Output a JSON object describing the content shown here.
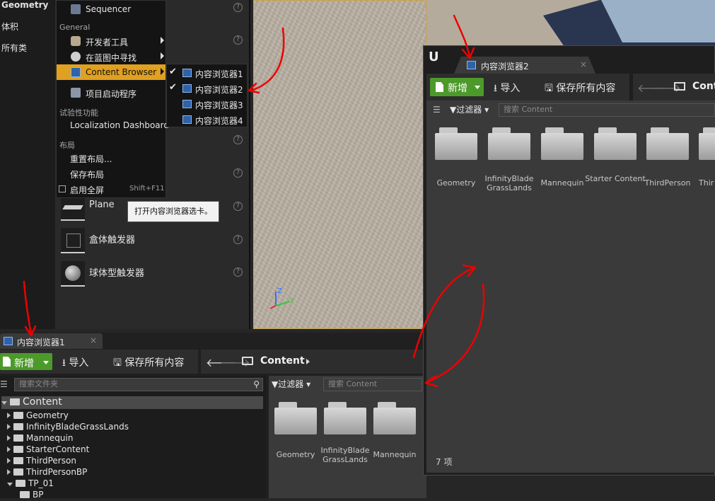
{
  "left_categories": [
    "Geometry",
    "体积",
    "所有类"
  ],
  "place_items": [
    {
      "label": "Plane"
    },
    {
      "label": "盒体触发器"
    },
    {
      "label": "球体型触发器"
    }
  ],
  "window_menu": {
    "top_item": "Sequencer",
    "section_general": "General",
    "dev_tools": "开发者工具",
    "find_in_blueprints": "在蓝图中寻找",
    "content_browser": "Content Browser",
    "project_launcher": "项目启动程序",
    "section_experimental": "试验性功能",
    "localization_dashboard": "Localization Dashboard",
    "section_layout": "布局",
    "reset_layout": "重置布局...",
    "save_layout": "保存布局",
    "fullscreen": "启用全屏",
    "fullscreen_shortcut": "Shift+F11"
  },
  "submenu": {
    "items": [
      {
        "label": "内容浏览器1",
        "checked": true
      },
      {
        "label": "内容浏览器2",
        "checked": true
      },
      {
        "label": "内容浏览器3",
        "checked": false
      },
      {
        "label": "内容浏览器4",
        "checked": false
      }
    ]
  },
  "tooltip": "打开内容浏览器选卡。",
  "browser1": {
    "tab_label": "内容浏览器1",
    "tab_close": "×",
    "new_label": "新增",
    "import_label": "导入",
    "save_all_label": "保存所有内容",
    "path": "Content",
    "folder_search_placeholder": "搜索文件夹",
    "filter_label": "过滤器",
    "search_placeholder": "搜索 Content",
    "tree_root": "Content",
    "tree_items": [
      "Geometry",
      "InfinityBladeGrassLands",
      "Mannequin",
      "StarterContent",
      "ThirdPerson",
      "ThirdPersonBP",
      "TP_01",
      "BP"
    ],
    "folders": [
      "Geometry",
      "InfinityBlade GrassLands",
      "Mannequin"
    ]
  },
  "browser2": {
    "tab_label": "内容浏览器2",
    "tab_close": "×",
    "new_label": "新增",
    "import_label": "导入",
    "save_all_label": "保存所有内容",
    "path": "Conte",
    "filter_label": "过滤器",
    "search_placeholder": "搜索 Content",
    "folders": [
      "Geometry",
      "InfinityBlade GrassLands",
      "Mannequin",
      "Starter Content",
      "ThirdPerson",
      "Thir"
    ],
    "item_count": "7 项"
  },
  "icons": [
    "sequencer-icon",
    "dev-tools-icon",
    "find-icon",
    "content-browser-icon",
    "launcher-icon",
    "checkbox-icon",
    "unreal-logo-icon",
    "filter-icon",
    "search-icon",
    "back-arrow-icon",
    "forward-arrow-icon",
    "folder-icon",
    "save-icon",
    "import-icon",
    "axis-gizmo-icon"
  ],
  "colors": {
    "accent_orange": "#e0a020",
    "new_button_green": "#4c9a2a",
    "annotation_red": "#e00000"
  }
}
